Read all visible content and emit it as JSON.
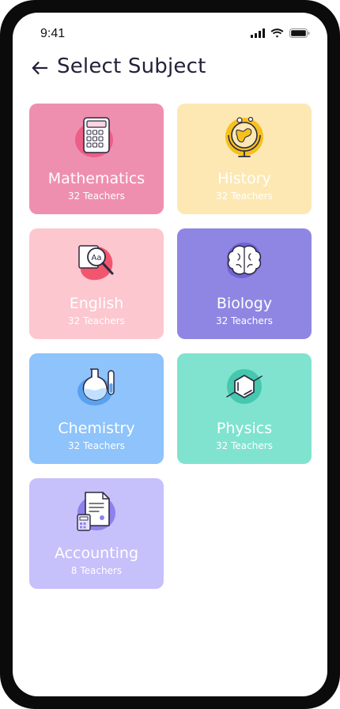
{
  "status_bar": {
    "time": "9:41"
  },
  "header": {
    "title": "Select Subject"
  },
  "subjects": [
    {
      "name": "Mathematics",
      "teachers": "32 Teachers",
      "bg": "#ef8fb0",
      "blob": "#ec5f86",
      "icon": "calculator-icon"
    },
    {
      "name": "History",
      "teachers": "32 Teachers",
      "bg": "#fde8b4",
      "blob": "#f6c01d",
      "icon": "globe-icon"
    },
    {
      "name": "English",
      "teachers": "32 Teachers",
      "bg": "#fcc7cf",
      "blob": "#f2566f",
      "icon": "dictionary-magnifier-icon"
    },
    {
      "name": "Biology",
      "teachers": "32 Teachers",
      "bg": "#8f86e3",
      "blob": "#7264d6",
      "icon": "brain-icon"
    },
    {
      "name": "Chemistry",
      "teachers": "32 Teachers",
      "bg": "#8ec3fb",
      "blob": "#5aa1ef",
      "icon": "flask-icon"
    },
    {
      "name": "Physics",
      "teachers": "32 Teachers",
      "bg": "#80e3cf",
      "blob": "#45c8ad",
      "icon": "molecule-icon"
    },
    {
      "name": "Accounting",
      "teachers": "8 Teachers",
      "bg": "#c6c0fb",
      "blob": "#8f81ec",
      "icon": "ledger-calculator-icon"
    }
  ]
}
